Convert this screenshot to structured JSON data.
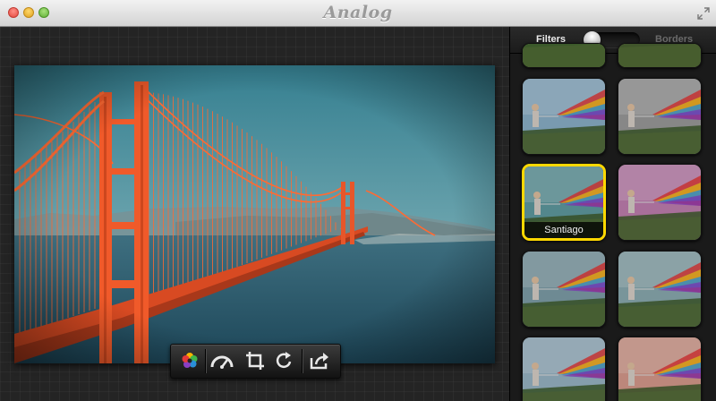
{
  "window": {
    "app_title": "Analog",
    "traffic_lights": [
      "close",
      "minimize",
      "zoom"
    ]
  },
  "toolbar": {
    "tools": [
      {
        "name": "color-wheel-icon"
      },
      {
        "name": "gauge-icon"
      },
      {
        "name": "crop-icon"
      },
      {
        "name": "rotate-icon"
      },
      {
        "name": "share-icon"
      }
    ]
  },
  "sidebar": {
    "segment_left": "Filters",
    "segment_right": "Borders",
    "active_segment": "Filters",
    "selected_filter": "Santiago",
    "thumbnails": [
      {
        "tint": "#6fa84a",
        "partial": true
      },
      {
        "tint": "#8a8850",
        "partial": true
      },
      {
        "tint": "#8ab0c8"
      },
      {
        "tint": "#9a9a9a"
      },
      {
        "tint": "#5f9aa0",
        "label": "Santiago"
      },
      {
        "tint": "#c07fb0"
      },
      {
        "tint": "#7e9ea8"
      },
      {
        "tint": "#8aaab0"
      },
      {
        "tint": "#98b4c4"
      },
      {
        "tint": "#d69a8c"
      }
    ]
  },
  "colors": {
    "accent_selected": "#ffd800",
    "bridge": "#f0582a",
    "sea": "#2f5a6e",
    "sky_top": "#3e8a9b",
    "sky_bottom": "#9fbec3"
  }
}
